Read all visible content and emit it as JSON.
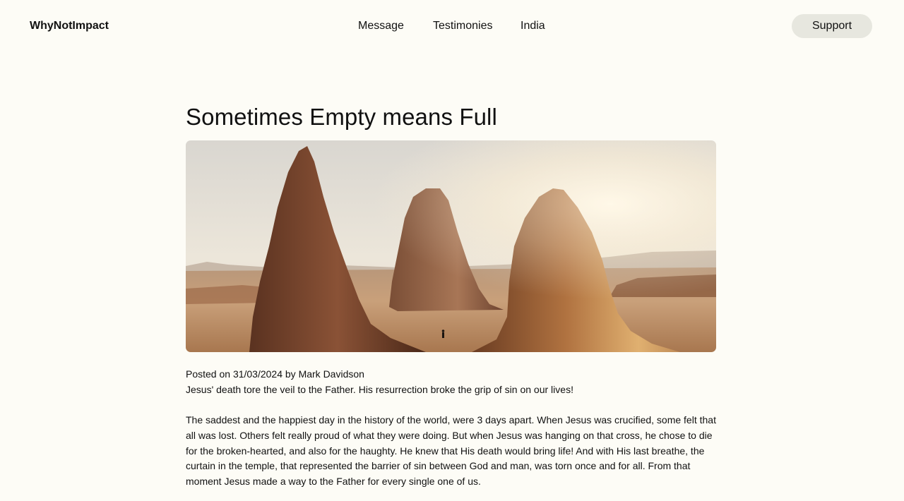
{
  "header": {
    "logo": "WhyNotImpact",
    "nav": [
      {
        "label": "Message"
      },
      {
        "label": "Testimonies"
      },
      {
        "label": "India"
      }
    ],
    "support_label": "Support"
  },
  "article": {
    "title": "Sometimes Empty means Full",
    "meta": "Posted on 31/03/2024 by Mark Davidson",
    "lead": "Jesus' death tore the veil to the Father. His resurrection broke the grip of sin on our lives!",
    "body": "The saddest and the happiest day in the history of the world, were 3 days apart. When Jesus was crucified, some felt that all was lost. Others felt really proud of what they were doing. But when Jesus was hanging on that cross, he chose to die for the broken-hearted, and also for the haughty. He knew that His death would bring life! And with His last breathe, the curtain in the temple, that represented the barrier of sin between God and man, was torn once and for all. From that moment Jesus made a way to the Father for every single one of us."
  },
  "colors": {
    "background": "#fdfcf6",
    "support_button": "#e7e7df",
    "text": "#111111"
  }
}
